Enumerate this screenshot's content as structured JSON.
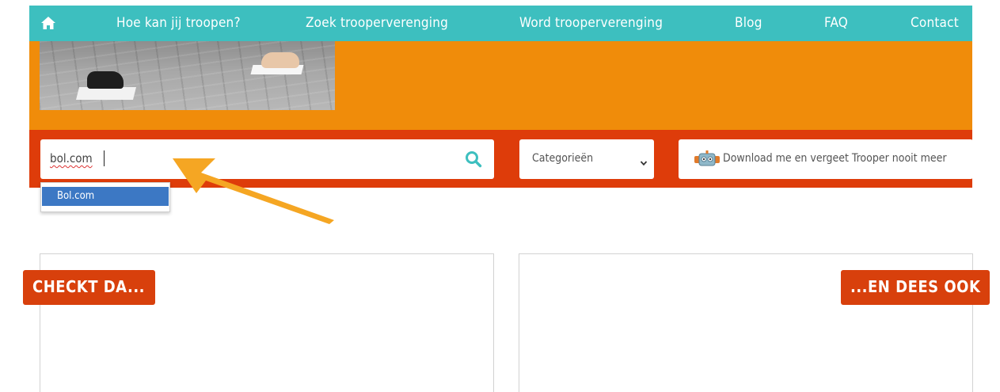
{
  "nav": {
    "home_icon": "home-icon",
    "items": [
      {
        "label": "Hoe kan jij troopen?"
      },
      {
        "label": "Zoek trooperverenging"
      },
      {
        "label": "Word trooperverenging"
      },
      {
        "label": "Blog"
      },
      {
        "label": "FAQ"
      },
      {
        "label": "Contact"
      }
    ]
  },
  "search": {
    "value": "bol.com",
    "icon": "search-icon"
  },
  "category_select": {
    "selected": "Categorieën",
    "icon": "chevron-down-icon"
  },
  "download": {
    "icon": "robot-icon",
    "label": "Download me en vergeet Trooper nooit meer"
  },
  "autocomplete": {
    "items": [
      {
        "label": "Bol.com"
      }
    ]
  },
  "panels": {
    "left_tag": "CHECKT DA...",
    "right_tag": "...EN DEES OOK"
  },
  "colors": {
    "nav": "#3dbfbf",
    "orange": "#f08c0a",
    "red": "#de3c0a",
    "teal_icon": "#3dbfbf",
    "highlight": "#3c78c4"
  }
}
